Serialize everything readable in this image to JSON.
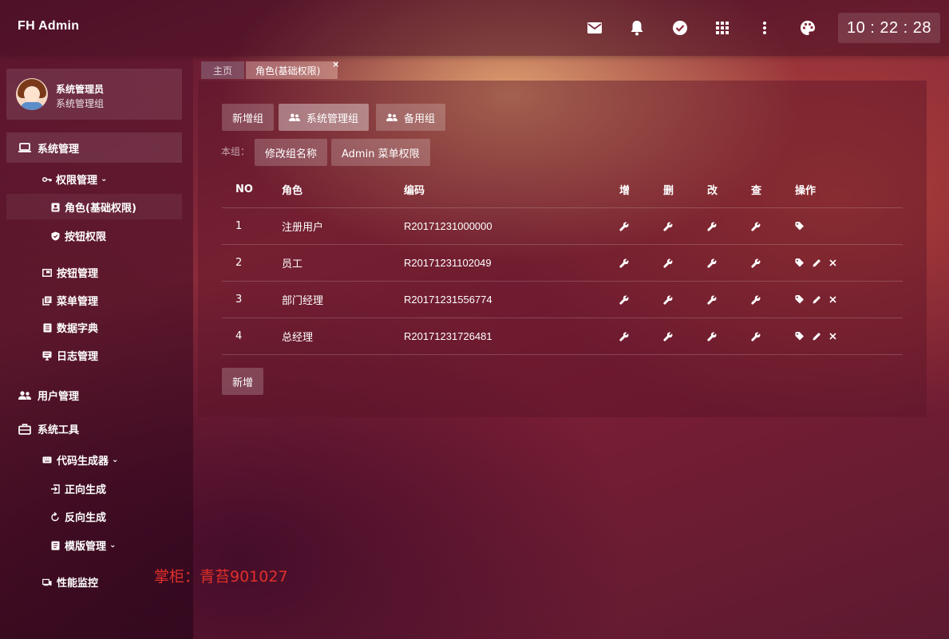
{
  "header": {
    "brand": "FH Admin",
    "icons": [
      "mail-icon",
      "bell-icon",
      "check-circle-icon",
      "apps-grid-icon",
      "more-vert-icon",
      "palette-icon"
    ],
    "clock": "10 : 22 : 28"
  },
  "sidebar": {
    "user": {
      "name": "系统管理员",
      "group": "系统管理组"
    },
    "items": [
      {
        "label": "系统管理",
        "icon": "laptop-icon"
      },
      {
        "label": "权限管理",
        "icon": "key-icon"
      },
      {
        "label": "角色(基础权限)",
        "icon": "badge-icon"
      },
      {
        "label": "按钮权限",
        "icon": "shield-icon"
      },
      {
        "label": "按钮管理",
        "icon": "window-icon"
      },
      {
        "label": "菜单管理",
        "icon": "layers-icon"
      },
      {
        "label": "数据字典",
        "icon": "book-icon"
      },
      {
        "label": "日志管理",
        "icon": "monitor-icon"
      },
      {
        "label": "用户管理",
        "icon": "users-icon"
      },
      {
        "label": "系统工具",
        "icon": "briefcase-icon"
      },
      {
        "label": "代码生成器",
        "icon": "keyboard-icon"
      },
      {
        "label": "正向生成",
        "icon": "login-icon"
      },
      {
        "label": "反向生成",
        "icon": "refresh-icon"
      },
      {
        "label": "模版管理",
        "icon": "file-icon"
      },
      {
        "label": "性能监控",
        "icon": "devices-icon"
      }
    ]
  },
  "tabs": [
    {
      "label": "主页"
    },
    {
      "label": "角色(基础权限)",
      "close": "×"
    }
  ],
  "main": {
    "group_buttons": [
      "新增组",
      "系统管理组",
      "备用组"
    ],
    "sub_label": "本组：",
    "sub_buttons": [
      "修改组名称",
      "Admin 菜单权限"
    ],
    "table": {
      "headers": [
        "NO",
        "角色",
        "编码",
        "增",
        "删",
        "改",
        "查",
        "操作"
      ],
      "rows": [
        {
          "no": "1",
          "role": "注册用户",
          "code": "R20171231000000",
          "ops": [
            "tag"
          ]
        },
        {
          "no": "2",
          "role": "员工",
          "code": "R20171231102049",
          "ops": [
            "tag",
            "edit",
            "delete"
          ]
        },
        {
          "no": "3",
          "role": "部门经理",
          "code": "R20171231556774",
          "ops": [
            "tag",
            "edit",
            "delete"
          ]
        },
        {
          "no": "4",
          "role": "总经理",
          "code": "R20171231726481",
          "ops": [
            "tag",
            "edit",
            "delete"
          ]
        }
      ]
    },
    "add_button": "新增"
  },
  "watermark": "掌柜：青苔901027",
  "colors": {
    "accent": "#e0302a"
  }
}
